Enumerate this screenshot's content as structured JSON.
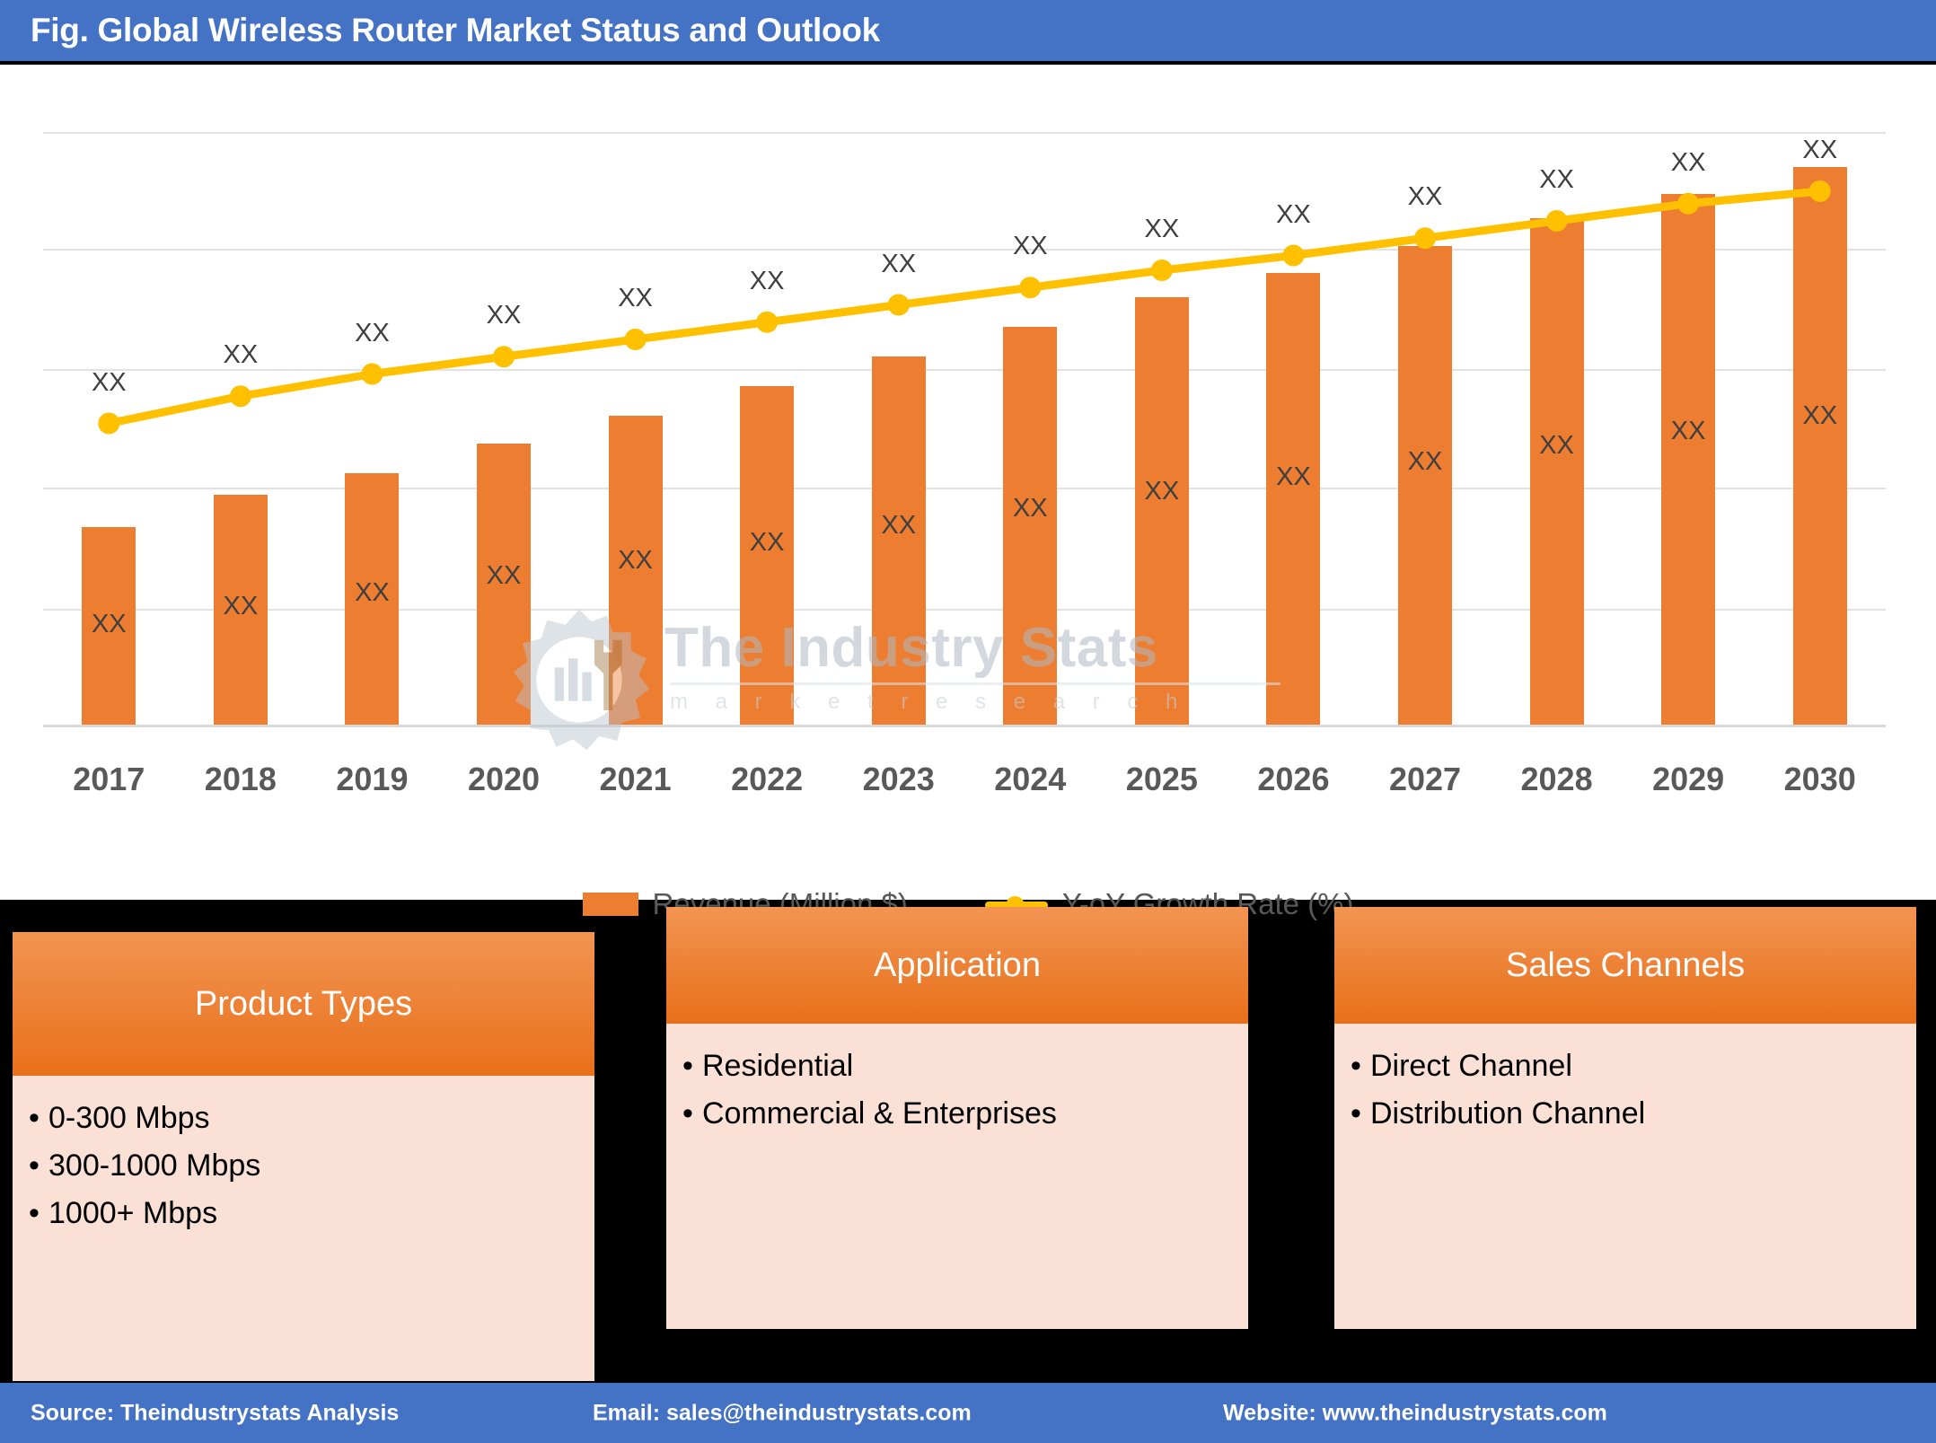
{
  "header": {
    "title": "Fig. Global Wireless Router Market Status and Outlook"
  },
  "watermark": {
    "text": "The Industry Stats",
    "subtext": "m a r k e t   r e s e a r c h"
  },
  "legend": {
    "revenue_label": "Revenue (Million $)",
    "growth_label": "Y-oY Growth Rate (%)"
  },
  "chart_data": {
    "type": "bar",
    "title": "Fig. Global Wireless Router Market Status and Outlook",
    "xlabel": "",
    "ylabel": "",
    "grid": true,
    "legend_position": "bottom",
    "categories": [
      "2017",
      "2018",
      "2019",
      "2020",
      "2021",
      "2022",
      "2023",
      "2024",
      "2025",
      "2026",
      "2027",
      "2028",
      "2029",
      "2030"
    ],
    "series": [
      {
        "name": "Revenue (Million $)",
        "type": "bar",
        "color": "#ED7D31",
        "axis": "left",
        "values": [
          40.0,
          46.5,
          51.0,
          57.0,
          62.5,
          68.5,
          74.5,
          80.5,
          86.5,
          91.5,
          97.0,
          102.5,
          107.5,
          113.0
        ],
        "data_labels": [
          "XX",
          "XX",
          "XX",
          "XX",
          "XX",
          "XX",
          "XX",
          "XX",
          "XX",
          "XX",
          "XX",
          "XX",
          "XX",
          "XX"
        ]
      },
      {
        "name": "Y-oY Growth Rate (%)",
        "type": "line",
        "color": "#FFC000",
        "axis": "right",
        "values": [
          61.0,
          66.5,
          71.0,
          74.5,
          78.0,
          81.5,
          85.0,
          88.5,
          92.0,
          95.0,
          98.5,
          102.0,
          105.5,
          108.0
        ],
        "data_labels": [
          "XX",
          "XX",
          "XX",
          "XX",
          "XX",
          "XX",
          "XX",
          "XX",
          "XX",
          "XX",
          "XX",
          "XX",
          "XX",
          "XX"
        ]
      }
    ],
    "ylim": [
      0,
      130
    ],
    "gridline_values": [
      130,
      108,
      86,
      64,
      42,
      20
    ]
  },
  "panels": [
    {
      "title": "Product Types",
      "items": [
        "0-300 Mbps",
        "300-1000 Mbps",
        "1000+ Mbps"
      ]
    },
    {
      "title": "Application",
      "items": [
        "Residential",
        "Commercial & Enterprises"
      ]
    },
    {
      "title": "Sales Channels",
      "items": [
        "Direct Channel",
        "Distribution Channel"
      ]
    }
  ],
  "footer": {
    "source": "Source: Theindustrystats Analysis",
    "email": "Email: sales@theindustrystats.com",
    "website": "Website: www.theindustrystats.com"
  },
  "colors": {
    "header_blue": "#4472C4",
    "bar_orange": "#ED7D31",
    "line_yellow": "#FFC000",
    "panel_body": "#FBE0D5",
    "background": "#000000"
  }
}
